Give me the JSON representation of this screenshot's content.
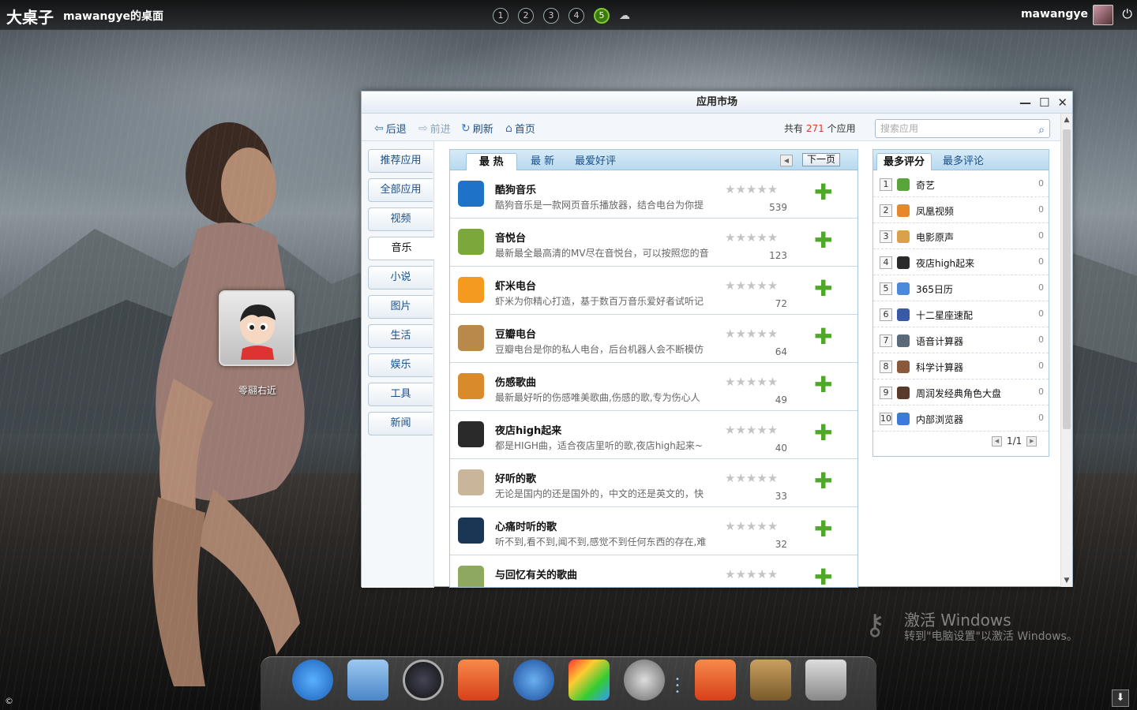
{
  "topbar": {
    "logo": "大桌子",
    "desktop_title": "mawangye的桌面",
    "desktops": [
      "1",
      "2",
      "3",
      "4",
      "5"
    ],
    "active_desktop": "5",
    "username": "mawangye",
    "icons": {
      "cloud": "cloud-icon",
      "power": "power-icon"
    }
  },
  "desktop_icon": {
    "label": "零翮右近"
  },
  "window": {
    "title": "应用市场",
    "toolbar": {
      "back": "后退",
      "forward": "前进",
      "refresh": "刷新",
      "home": "首页",
      "count_prefix": "共有",
      "count_value": "271",
      "count_suffix": "个应用",
      "search_placeholder": "搜索应用"
    },
    "sidebar": [
      "推荐应用",
      "全部应用",
      "视频",
      "音乐",
      "小说",
      "图片",
      "生活",
      "娱乐",
      "工具",
      "新闻"
    ],
    "sidebar_active": "音乐",
    "list_tabs": [
      "最 热",
      "最 新",
      "最爱好评"
    ],
    "list_active_tab": "最 热",
    "next_page": "下一页",
    "apps": [
      {
        "name": "酷狗音乐",
        "desc": "酷狗音乐是一款网页音乐播放器，结合电台为你提",
        "count": "539",
        "color": "#1e73c8"
      },
      {
        "name": "音悦台",
        "desc": "最新最全最高清的MV尽在音悦台，可以按照您的音",
        "count": "123",
        "color": "#7aa83a"
      },
      {
        "name": "虾米电台",
        "desc": "虾米为你精心打造，基于数百万音乐爱好者试听记",
        "count": "72",
        "color": "#f39a1f"
      },
      {
        "name": "豆瓣电台",
        "desc": "豆瓣电台是你的私人电台，后台机器人会不断模仿",
        "count": "64",
        "color": "#b8894a"
      },
      {
        "name": "伤感歌曲",
        "desc": "最新最好听的伤感唯美歌曲,伤感的歌,专为伤心人",
        "count": "49",
        "color": "#d98a2a"
      },
      {
        "name": "夜店high起来",
        "desc": "都是HIGH曲，适合夜店里听的歌,夜店high起来~",
        "count": "40",
        "color": "#2a2a2a"
      },
      {
        "name": "好听的歌",
        "desc": "无论是国内的还是国外的，中文的还是英文的，快",
        "count": "33",
        "color": "#c9b59a"
      },
      {
        "name": "心痛时听的歌",
        "desc": "听不到,看不到,闻不到,感觉不到任何东西的存在,难",
        "count": "32",
        "color": "#1b3554"
      },
      {
        "name": "与回忆有关的歌曲",
        "desc": "",
        "count": "",
        "color": "#8ea860"
      }
    ],
    "rating_stars": "★★★★★",
    "add_symbol": "✚",
    "right_tabs": [
      "最多评分",
      "最多评论"
    ],
    "right_active_tab": "最多评分",
    "ranking": [
      {
        "rank": "1",
        "name": "奇艺",
        "count": "0",
        "color": "#5aa53a"
      },
      {
        "rank": "2",
        "name": "凤凰视频",
        "count": "0",
        "color": "#e8862a"
      },
      {
        "rank": "3",
        "name": "电影原声",
        "count": "0",
        "color": "#d9a24a"
      },
      {
        "rank": "4",
        "name": "夜店high起来",
        "count": "0",
        "color": "#2a2a2a"
      },
      {
        "rank": "5",
        "name": "365日历",
        "count": "0",
        "color": "#4a8ad8"
      },
      {
        "rank": "6",
        "name": "十二星座速配",
        "count": "0",
        "color": "#3a5aa8"
      },
      {
        "rank": "7",
        "name": "语音计算器",
        "count": "0",
        "color": "#5a6a7a"
      },
      {
        "rank": "8",
        "name": "科学计算器",
        "count": "0",
        "color": "#8a5a3a"
      },
      {
        "rank": "9",
        "name": "周润发经典角色大盘",
        "count": "0",
        "color": "#5a3a2a"
      },
      {
        "rank": "10",
        "name": "内部浏览器",
        "count": "0",
        "color": "#3a7ad8"
      }
    ],
    "ranking_pager": "1/1"
  },
  "dock": [
    "ie-icon",
    "folder-icon",
    "gauge-icon",
    "app-store-icon",
    "globe-icon",
    "paint-icon",
    "settings-icon",
    "app-store-icon-2",
    "books-icon",
    "trash-icon"
  ],
  "watermark": {
    "title": "激活 Windows",
    "subtitle": "转到\"电脑设置\"以激活 Windows。"
  },
  "copyright": "©"
}
